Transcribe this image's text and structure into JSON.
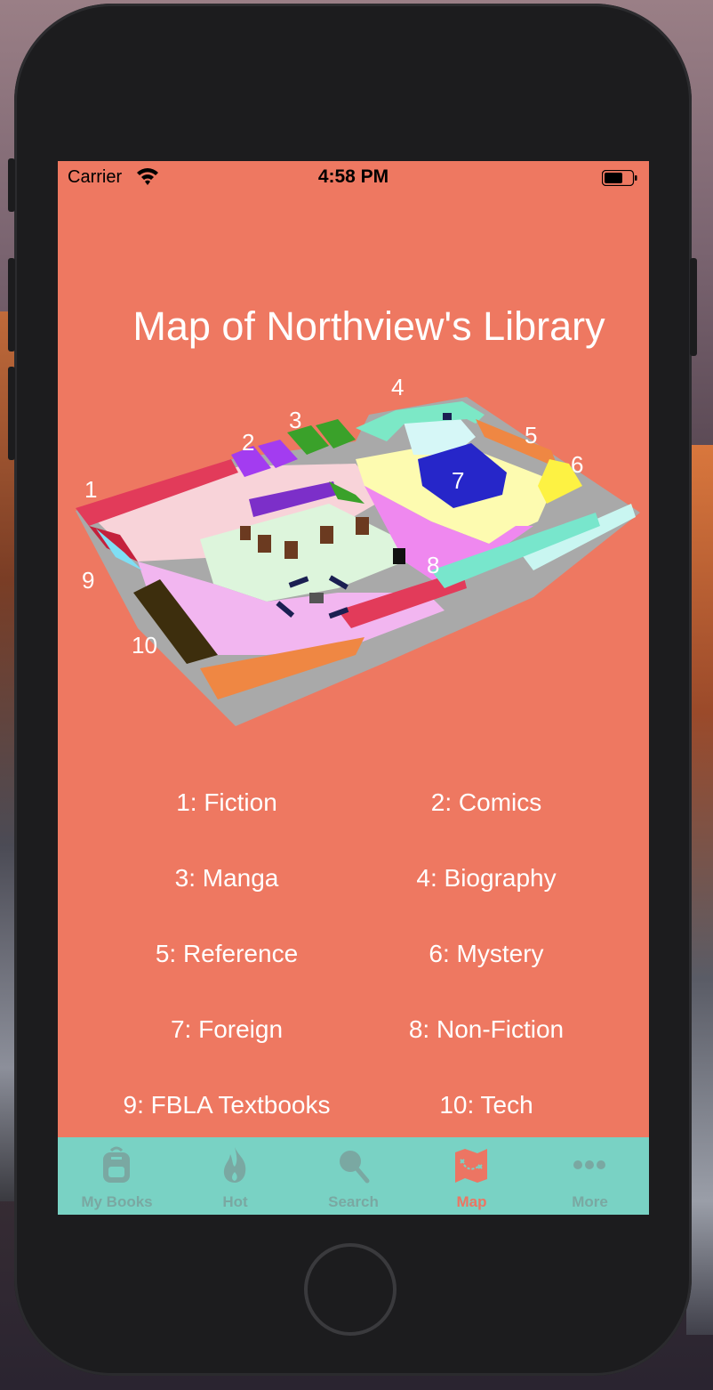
{
  "status_bar": {
    "carrier": "Carrier",
    "time": "4:58 PM"
  },
  "page": {
    "title": "Map of Northview's Library"
  },
  "map": {
    "labels": [
      "1",
      "2",
      "3",
      "4",
      "5",
      "6",
      "7",
      "8",
      "9",
      "10"
    ]
  },
  "legend": [
    {
      "text": "1: Fiction"
    },
    {
      "text": "2: Comics"
    },
    {
      "text": "3: Manga"
    },
    {
      "text": "4: Biography"
    },
    {
      "text": "5: Reference"
    },
    {
      "text": "6: Mystery"
    },
    {
      "text": "7: Foreign"
    },
    {
      "text": "8: Non-Fiction"
    },
    {
      "text": "9: FBLA Textbooks"
    },
    {
      "text": "10: Tech"
    }
  ],
  "tabs": [
    {
      "label": "My Books",
      "icon": "backpack-icon"
    },
    {
      "label": "Hot",
      "icon": "flame-icon"
    },
    {
      "label": "Search",
      "icon": "magnifier-icon"
    },
    {
      "label": "Map",
      "icon": "map-icon",
      "active": true
    },
    {
      "label": "More",
      "icon": "more-dots-icon"
    }
  ],
  "colors": {
    "screen_bg": "#ee7861",
    "tab_bar_bg": "#79d2c4",
    "tab_active": "#ec7563",
    "tab_inactive": "#7aa8a2"
  }
}
